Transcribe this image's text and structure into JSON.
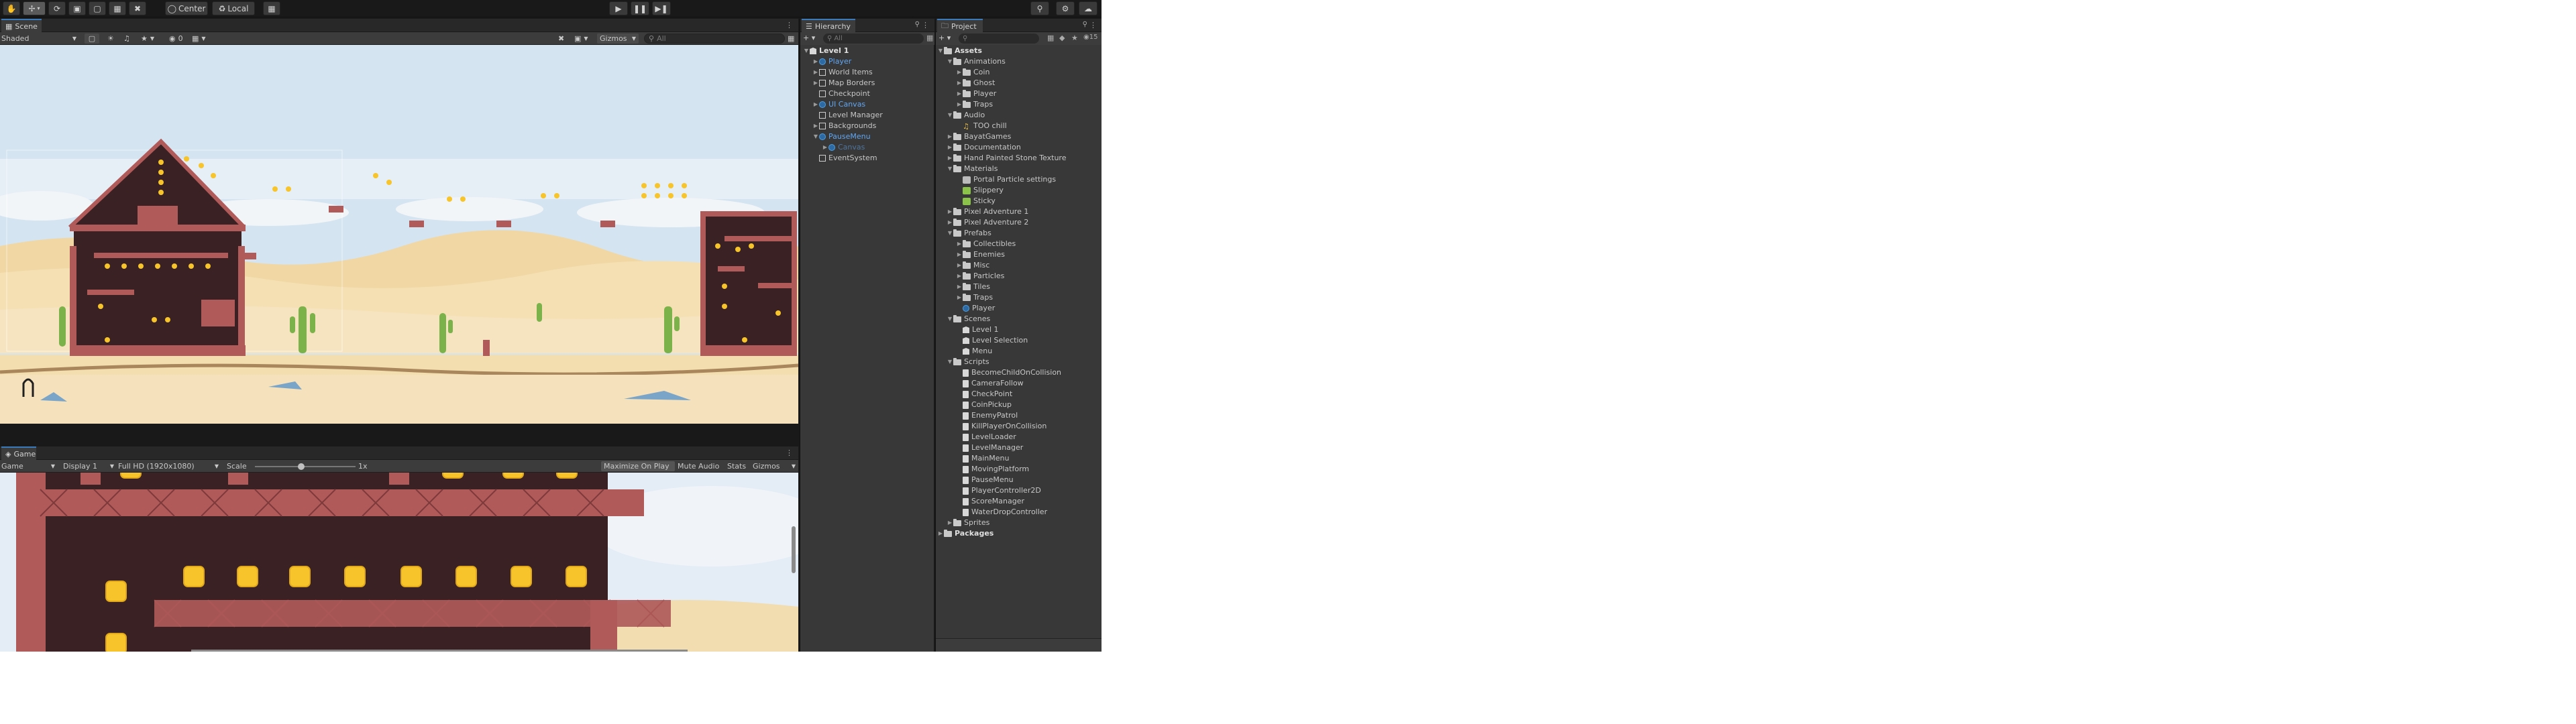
{
  "toolbar": {
    "pivot_label": "Center",
    "space_label": "Local"
  },
  "scene_panel": {
    "tab_label": "Scene",
    "shading_mode": "Shaded",
    "gizmos_label": "Gizmos",
    "search_placeholder": "All"
  },
  "game_panel": {
    "tab_label": "Game",
    "mode": "Game",
    "display": "Display 1",
    "resolution": "Full HD (1920x1080)",
    "scale_label": "Scale",
    "scale_value": "1x",
    "maximize_label": "Maximize On Play",
    "mute_label": "Mute Audio",
    "stats_label": "Stats",
    "gizmos_label": "Gizmos"
  },
  "hierarchy": {
    "tab_label": "Hierarchy",
    "search_placeholder": "All",
    "items": [
      {
        "label": "Level 1",
        "indent": 0,
        "expanded": true,
        "type": "scene",
        "bold": true
      },
      {
        "label": "Player",
        "indent": 1,
        "expanded": false,
        "type": "prefab",
        "blue": true
      },
      {
        "label": "World Items",
        "indent": 1,
        "expanded": false,
        "type": "cube"
      },
      {
        "label": "Map Borders",
        "indent": 1,
        "expanded": false,
        "type": "cube"
      },
      {
        "label": "Checkpoint",
        "indent": 1,
        "expanded": null,
        "type": "cube"
      },
      {
        "label": "UI Canvas",
        "indent": 1,
        "expanded": false,
        "type": "prefab",
        "blue": true
      },
      {
        "label": "Level Manager",
        "indent": 1,
        "expanded": null,
        "type": "cube"
      },
      {
        "label": "Backgrounds",
        "indent": 1,
        "expanded": false,
        "type": "cube"
      },
      {
        "label": "PauseMenu",
        "indent": 1,
        "expanded": true,
        "type": "prefab",
        "blue": true
      },
      {
        "label": "Canvas",
        "indent": 2,
        "expanded": false,
        "type": "prefab",
        "blue": true,
        "dim": true
      },
      {
        "label": "EventSystem",
        "indent": 1,
        "expanded": null,
        "type": "cube"
      }
    ]
  },
  "project": {
    "tab_label": "Project",
    "search_placeholder": "",
    "hidden_count": "15",
    "items": [
      {
        "label": "Assets",
        "indent": 0,
        "expanded": true,
        "type": "folder",
        "bold": true
      },
      {
        "label": "Animations",
        "indent": 1,
        "expanded": true,
        "type": "folder"
      },
      {
        "label": "Coin",
        "indent": 2,
        "expanded": false,
        "type": "folder"
      },
      {
        "label": "Ghost",
        "indent": 2,
        "expanded": false,
        "type": "folder"
      },
      {
        "label": "Player",
        "indent": 2,
        "expanded": false,
        "type": "folder"
      },
      {
        "label": "Traps",
        "indent": 2,
        "expanded": false,
        "type": "folder"
      },
      {
        "label": "Audio",
        "indent": 1,
        "expanded": true,
        "type": "folder"
      },
      {
        "label": "TOO chill",
        "indent": 2,
        "expanded": null,
        "type": "audio"
      },
      {
        "label": "BayatGames",
        "indent": 1,
        "expanded": false,
        "type": "folder"
      },
      {
        "label": "Documentation",
        "indent": 1,
        "expanded": false,
        "type": "folder"
      },
      {
        "label": "Hand Painted Stone Texture",
        "indent": 1,
        "expanded": false,
        "type": "folder"
      },
      {
        "label": "Materials",
        "indent": 1,
        "expanded": true,
        "type": "folder"
      },
      {
        "label": "Portal Particle settings",
        "indent": 2,
        "expanded": null,
        "type": "material"
      },
      {
        "label": "Slippery",
        "indent": 2,
        "expanded": null,
        "type": "physmat"
      },
      {
        "label": "Sticky",
        "indent": 2,
        "expanded": null,
        "type": "physmat"
      },
      {
        "label": "Pixel Adventure 1",
        "indent": 1,
        "expanded": false,
        "type": "folder"
      },
      {
        "label": "Pixel Adventure 2",
        "indent": 1,
        "expanded": false,
        "type": "folder"
      },
      {
        "label": "Prefabs",
        "indent": 1,
        "expanded": true,
        "type": "folder"
      },
      {
        "label": "Collectibles",
        "indent": 2,
        "expanded": false,
        "type": "folder"
      },
      {
        "label": "Enemies",
        "indent": 2,
        "expanded": false,
        "type": "folder"
      },
      {
        "label": "Misc",
        "indent": 2,
        "expanded": false,
        "type": "folder"
      },
      {
        "label": "Particles",
        "indent": 2,
        "expanded": false,
        "type": "folder"
      },
      {
        "label": "Tiles",
        "indent": 2,
        "expanded": false,
        "type": "folder"
      },
      {
        "label": "Traps",
        "indent": 2,
        "expanded": false,
        "type": "folder"
      },
      {
        "label": "Player",
        "indent": 2,
        "expanded": null,
        "type": "prefab"
      },
      {
        "label": "Scenes",
        "indent": 1,
        "expanded": true,
        "type": "folder"
      },
      {
        "label": "Level 1",
        "indent": 2,
        "expanded": null,
        "type": "scene"
      },
      {
        "label": "Level Selection",
        "indent": 2,
        "expanded": null,
        "type": "scene"
      },
      {
        "label": "Menu",
        "indent": 2,
        "expanded": null,
        "type": "scene"
      },
      {
        "label": "Scripts",
        "indent": 1,
        "expanded": true,
        "type": "folder"
      },
      {
        "label": "BecomeChildOnCollision",
        "indent": 2,
        "expanded": null,
        "type": "script"
      },
      {
        "label": "CameraFollow",
        "indent": 2,
        "expanded": null,
        "type": "script"
      },
      {
        "label": "CheckPoint",
        "indent": 2,
        "expanded": null,
        "type": "script"
      },
      {
        "label": "CoinPickup",
        "indent": 2,
        "expanded": null,
        "type": "script"
      },
      {
        "label": "EnemyPatrol",
        "indent": 2,
        "expanded": null,
        "type": "script"
      },
      {
        "label": "KillPlayerOnCollision",
        "indent": 2,
        "expanded": null,
        "type": "script"
      },
      {
        "label": "LevelLoader",
        "indent": 2,
        "expanded": null,
        "type": "script"
      },
      {
        "label": "LevelManager",
        "indent": 2,
        "expanded": null,
        "type": "script"
      },
      {
        "label": "MainMenu",
        "indent": 2,
        "expanded": null,
        "type": "script"
      },
      {
        "label": "MovingPlatform",
        "indent": 2,
        "expanded": null,
        "type": "script"
      },
      {
        "label": "PauseMenu",
        "indent": 2,
        "expanded": null,
        "type": "script"
      },
      {
        "label": "PlayerController2D",
        "indent": 2,
        "expanded": null,
        "type": "script"
      },
      {
        "label": "ScoreManager",
        "indent": 2,
        "expanded": null,
        "type": "script"
      },
      {
        "label": "WaterDropController",
        "indent": 2,
        "expanded": null,
        "type": "script"
      },
      {
        "label": "Sprites",
        "indent": 1,
        "expanded": false,
        "type": "folder"
      },
      {
        "label": "Packages",
        "indent": 0,
        "expanded": false,
        "type": "folder",
        "bold": true
      }
    ]
  },
  "colors": {
    "accent": "#3a79bb",
    "prefab_blue": "#5fa7f5",
    "sky": "#c9dcec",
    "sand": "#f2d9a6",
    "brick": "#b05a5a",
    "dark_wall": "#3a2124",
    "coin": "#f7c52b"
  }
}
